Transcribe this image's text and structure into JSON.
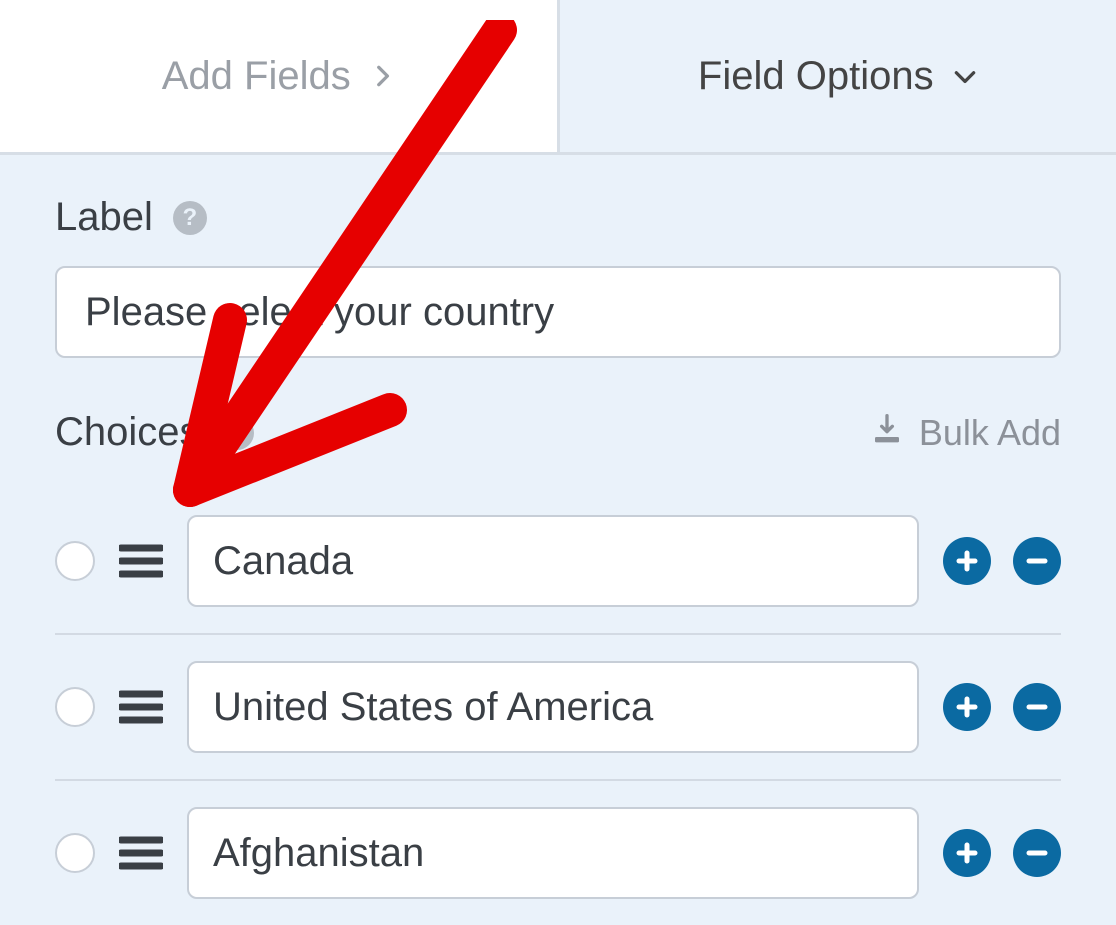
{
  "tabs": {
    "add_fields": "Add Fields",
    "field_options": "Field Options"
  },
  "label_section": {
    "title": "Label",
    "value": "Please select your country"
  },
  "choices_section": {
    "title": "Choices",
    "bulk_add": "Bulk Add",
    "items": [
      {
        "value": "Canada"
      },
      {
        "value": "United States of America"
      },
      {
        "value": "Afghanistan"
      }
    ]
  }
}
